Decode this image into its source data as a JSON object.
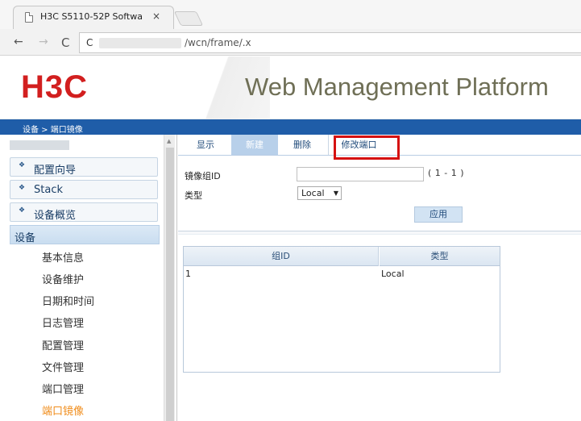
{
  "browser": {
    "tab_title": "H3C S5110-52P Softwa",
    "tab_close": "×",
    "back": "←",
    "forward": "→",
    "reload": "C",
    "url_prefix": "C",
    "url_suffix": "/wcn/frame/.x"
  },
  "header": {
    "logo": "H3C",
    "title": "Web Management Platform"
  },
  "breadcrumb": "设备 > 端口镜像",
  "sidebar": {
    "scroll_up": "▲",
    "groups": [
      {
        "label": "配置向导"
      },
      {
        "label": "Stack"
      },
      {
        "label": "设备概览"
      }
    ],
    "active": "设备",
    "items": [
      {
        "label": "基本信息"
      },
      {
        "label": "设备维护"
      },
      {
        "label": "日期和时间"
      },
      {
        "label": "日志管理"
      },
      {
        "label": "配置管理"
      },
      {
        "label": "文件管理"
      },
      {
        "label": "端口管理"
      },
      {
        "label": "端口镜像"
      }
    ],
    "diamond": "❖"
  },
  "tabs": [
    {
      "label": "显示"
    },
    {
      "label": "新建"
    },
    {
      "label": "删除"
    },
    {
      "label": "修改端口"
    }
  ],
  "form": {
    "group_id_label": "镜像组ID",
    "group_id_value": "",
    "range_hint": "( 1 - 1 )",
    "type_label": "类型",
    "type_value": "Local",
    "type_arrow": "▼",
    "apply_label": "应用"
  },
  "table": {
    "headers": [
      "组ID",
      "类型"
    ],
    "rows": [
      [
        "1",
        "Local"
      ]
    ]
  }
}
